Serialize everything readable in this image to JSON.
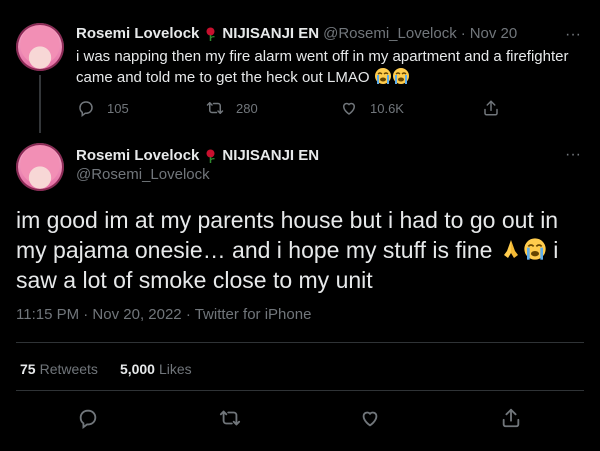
{
  "reply_tweet": {
    "display_name": "Rosemi Lovelock",
    "suffix": "NIJISANJI EN",
    "handle": "@Rosemi_Lovelock",
    "date": "Nov 20",
    "separator": "·",
    "text_line1": "i was napping then my fire alarm went off in my apartment and a firefighter",
    "text_line2": "came and told me to get the heck out LMAO",
    "replies": "105",
    "retweets": "280",
    "likes": "10.6K"
  },
  "main_tweet": {
    "display_name": "Rosemi Lovelock",
    "suffix": "NIJISANJI EN",
    "handle": "@Rosemi_Lovelock",
    "text_line1": "im good im at my parents house but i had to go out in",
    "text_line2": "my pajama onesie… and i hope my stuff is fine",
    "text_line2_tail": "i",
    "text_line3": "saw a lot of smoke close to my unit",
    "time": "11:15 PM · Nov 20, 2022 · Twitter for iPhone",
    "retweet_count": "75",
    "retweet_label": "Retweets",
    "like_count": "5,000",
    "like_label": "Likes"
  },
  "icons": {
    "more": "more-icon",
    "reply": "reply-icon",
    "retweet": "retweet-icon",
    "like": "heart-icon",
    "share": "share-icon",
    "rose": "rose-emoji",
    "crying": "loudly-crying-emoji",
    "pray": "folded-hands-emoji"
  },
  "colors": {
    "background": "#000000",
    "text": "#e7e9ea",
    "muted": "#71767b",
    "divider": "#2f3336"
  }
}
